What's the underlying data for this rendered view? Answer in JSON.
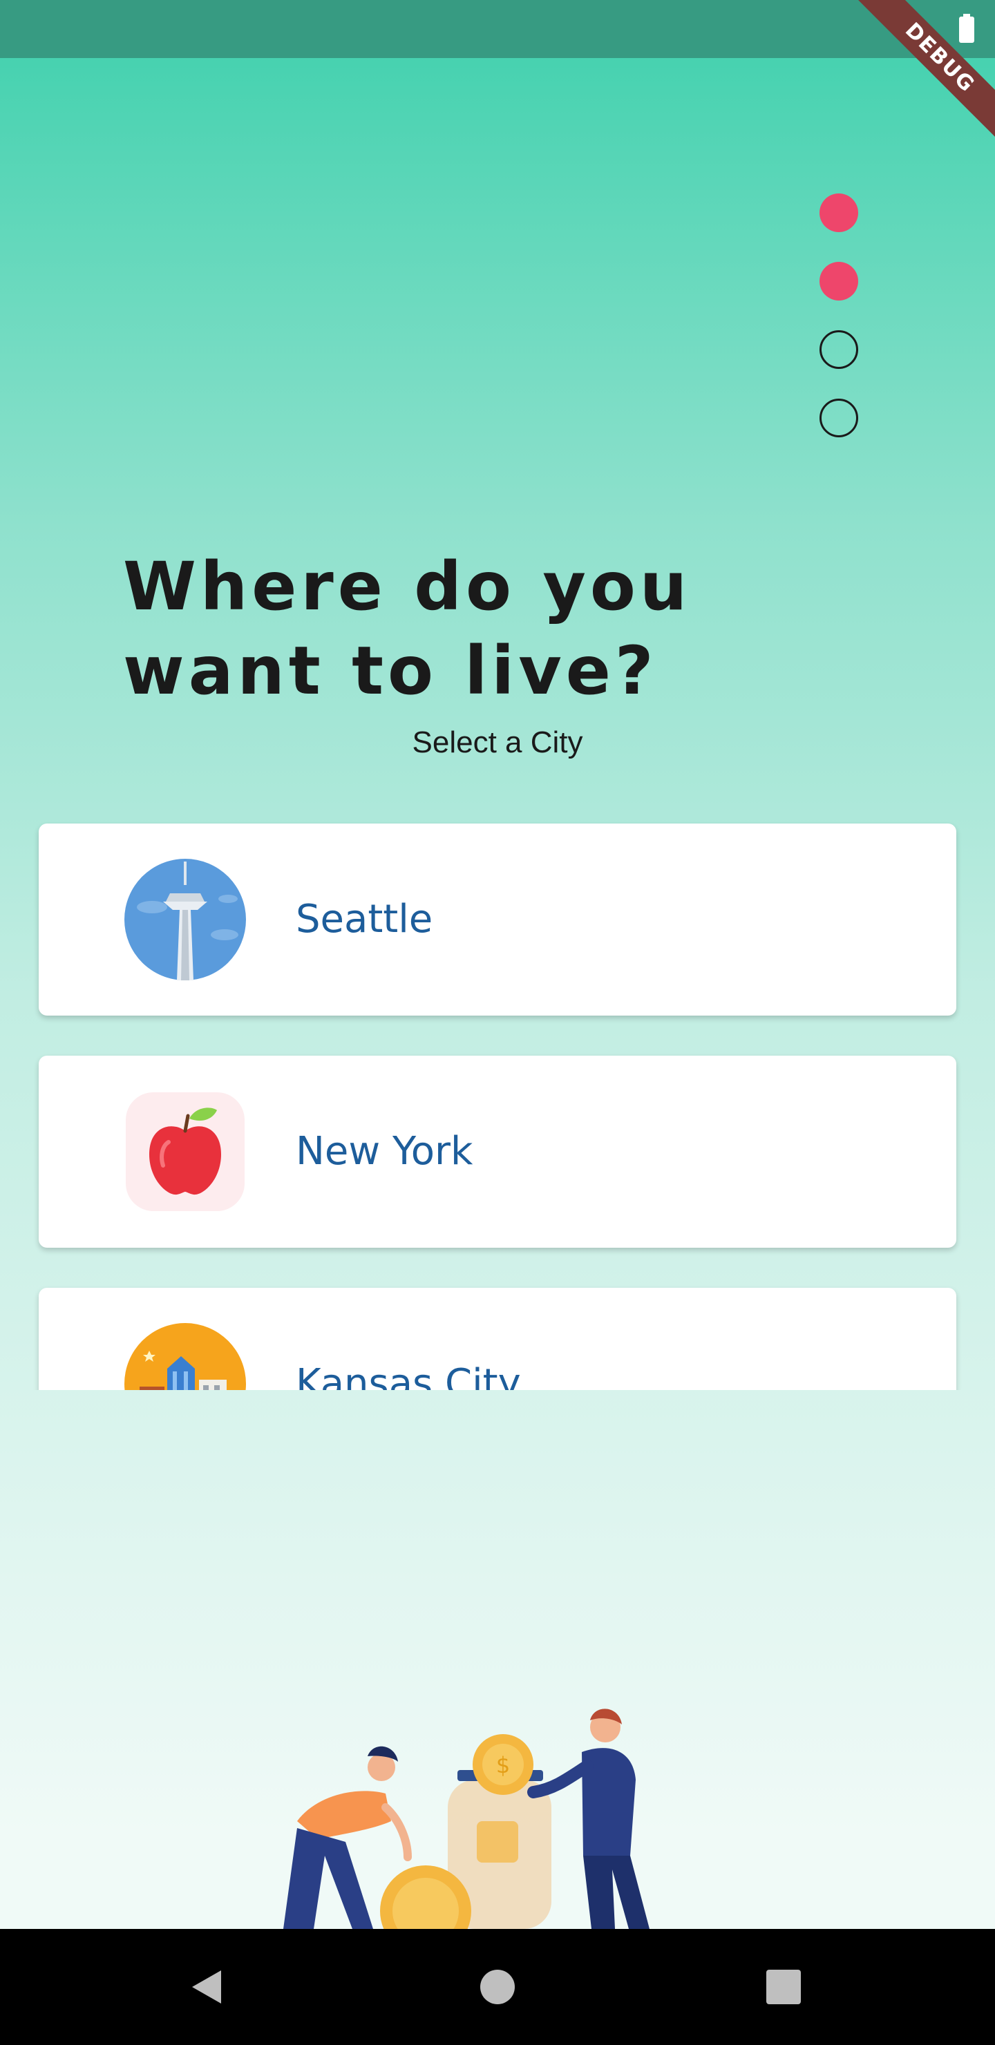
{
  "debug_banner": "DEBUG",
  "progress": {
    "total_steps": 4,
    "completed_steps": 2
  },
  "heading": "Where do you want to live?",
  "subheading": "Select a City",
  "cities": [
    {
      "name": "Seattle",
      "icon": "space-needle-icon"
    },
    {
      "name": "New York",
      "icon": "apple-icon"
    },
    {
      "name": "Kansas City",
      "icon": "city-skyline-icon"
    }
  ],
  "colors": {
    "accent_dot": "#ee466b",
    "city_text": "#1d5d9b",
    "status_bar": "#379b82",
    "gradient_top": "#47d2b0",
    "gradient_bottom": "#f0faf7"
  },
  "illustration": "people-saving-coins-illustration"
}
